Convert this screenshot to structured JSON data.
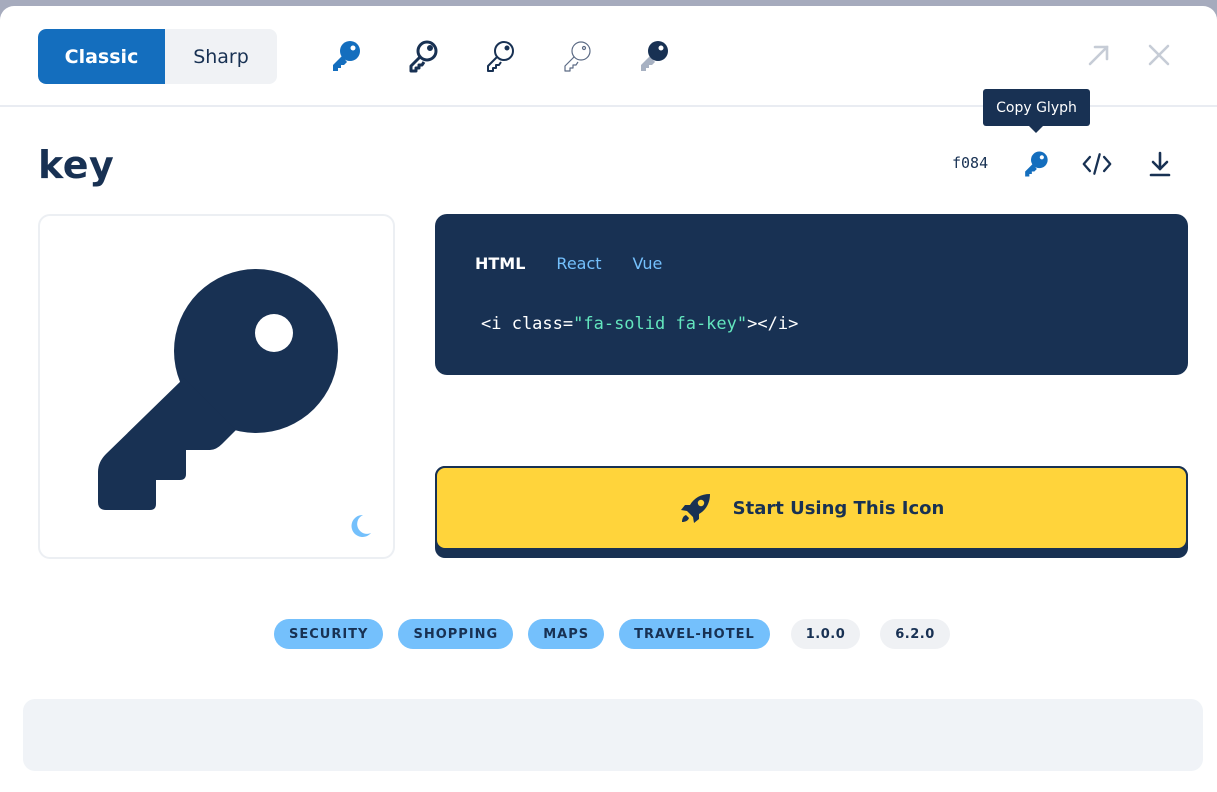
{
  "header": {
    "styles": [
      {
        "label": "Classic",
        "active": true
      },
      {
        "label": "Sharp",
        "active": false
      }
    ],
    "variants": [
      "solid",
      "regular",
      "light",
      "thin",
      "duotone"
    ],
    "actions": [
      "open-in-new-icon",
      "close-icon"
    ]
  },
  "tooltip": "Copy Glyph",
  "icon": {
    "name": "key",
    "unicode": "f084"
  },
  "title_actions": [
    "copy-glyph-key-icon",
    "code-icon",
    "download-icon"
  ],
  "code": {
    "tabs": [
      {
        "label": "HTML",
        "active": true
      },
      {
        "label": "React",
        "active": false
      },
      {
        "label": "Vue",
        "active": false
      }
    ],
    "prefix": "<i class=",
    "string": "\"fa-solid fa-key\"",
    "suffix": "></i>"
  },
  "start_button": "Start Using This Icon",
  "tags": [
    "SECURITY",
    "SHOPPING",
    "MAPS",
    "TRAVEL-HOTEL"
  ],
  "versions": [
    "1.0.0",
    "6.2.0"
  ],
  "colors": {
    "primary": "#146ebe",
    "navy": "#183153",
    "yellow": "#ffd43b",
    "light_blue": "#74c0fc",
    "mint": "#63e6be"
  }
}
